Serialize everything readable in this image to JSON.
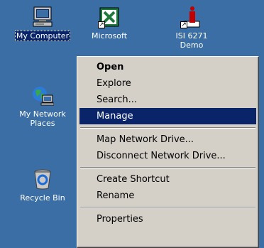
{
  "desktop": {
    "icons": [
      {
        "label": "My Computer",
        "icon": "my-computer-icon",
        "selected": true
      },
      {
        "label": "Microsoft",
        "icon": "excel-shortcut-icon"
      },
      {
        "label": "ISI 6271 Demo",
        "icon": "demo-shortcut-icon"
      },
      {
        "label": "My Network\nPlaces",
        "icon": "network-places-icon"
      },
      {
        "label": "Recycle Bin",
        "icon": "recycle-bin-icon"
      }
    ]
  },
  "context_menu": {
    "open": "Open",
    "explore": "Explore",
    "search": "Search...",
    "manage": "Manage",
    "map_drive": "Map Network Drive...",
    "disconnect_drive": "Disconnect Network Drive...",
    "create_shortcut": "Create Shortcut",
    "rename": "Rename",
    "properties": "Properties",
    "highlighted": "Manage"
  },
  "colors": {
    "desktop": "#3a6ea5",
    "menu_bg": "#d4d0c8",
    "highlight": "#0a246a"
  }
}
